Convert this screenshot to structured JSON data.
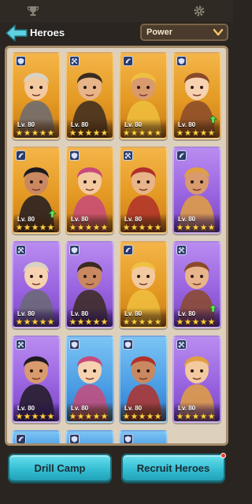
{
  "header": {
    "title": "Heroes",
    "sort_label": "Power",
    "icons": [
      "trophy-icon",
      "gear-icon",
      "back-arrow-icon",
      "chevron-down-icon"
    ]
  },
  "colors": {
    "orange_rarity": "#e49a24",
    "purple_rarity": "#9a64e0",
    "blue_rarity": "#4a9ce4",
    "button_cyan": "#35bfd4"
  },
  "heroes": [
    {
      "id": "hero-1",
      "level_text": "Lv. 80",
      "stars": 5,
      "rarity": "orange",
      "class": "shield",
      "upgrade": false
    },
    {
      "id": "hero-2",
      "level_text": "Lv. 80",
      "stars": 5,
      "rarity": "orange",
      "class": "sword",
      "upgrade": false
    },
    {
      "id": "hero-3",
      "level_text": "Lv. 80",
      "stars": 5,
      "rarity": "orange",
      "class": "magic",
      "upgrade": false
    },
    {
      "id": "hero-4",
      "level_text": "Lv. 80",
      "stars": 5,
      "rarity": "orange",
      "class": "shield",
      "upgrade": true
    },
    {
      "id": "hero-5",
      "level_text": "Lv. 80",
      "stars": 5,
      "rarity": "orange",
      "class": "magic",
      "upgrade": true
    },
    {
      "id": "hero-6",
      "level_text": "Lv. 80",
      "stars": 5,
      "rarity": "orange",
      "class": "shield",
      "upgrade": false
    },
    {
      "id": "hero-7",
      "level_text": "Lv. 80",
      "stars": 5,
      "rarity": "orange",
      "class": "sword",
      "upgrade": false
    },
    {
      "id": "hero-8",
      "level_text": "Lv. 80",
      "stars": 5,
      "rarity": "purple",
      "class": "magic",
      "upgrade": false
    },
    {
      "id": "hero-9",
      "level_text": "Lv. 80",
      "stars": 5,
      "rarity": "purple",
      "class": "sword",
      "upgrade": false
    },
    {
      "id": "hero-10",
      "level_text": "Lv. 80",
      "stars": 5,
      "rarity": "purple",
      "class": "shield",
      "upgrade": false
    },
    {
      "id": "hero-11",
      "level_text": "Lv. 80",
      "stars": 5,
      "rarity": "orange",
      "class": "magic",
      "upgrade": false
    },
    {
      "id": "hero-12",
      "level_text": "Lv. 80",
      "stars": 5,
      "rarity": "purple",
      "class": "sword",
      "upgrade": true
    },
    {
      "id": "hero-13",
      "level_text": "Lv. 80",
      "stars": 5,
      "rarity": "purple",
      "class": "sword",
      "upgrade": false
    },
    {
      "id": "hero-14",
      "level_text": "Lv. 80",
      "stars": 5,
      "rarity": "blue",
      "class": "shield",
      "upgrade": false
    },
    {
      "id": "hero-15",
      "level_text": "Lv. 80",
      "stars": 5,
      "rarity": "blue",
      "class": "shield",
      "upgrade": false
    },
    {
      "id": "hero-16",
      "level_text": "Lv. 80",
      "stars": 5,
      "rarity": "purple",
      "class": "sword",
      "upgrade": false
    },
    {
      "id": "hero-17",
      "level_text": "",
      "stars": 0,
      "rarity": "blue",
      "class": "magic",
      "upgrade": false
    },
    {
      "id": "hero-18",
      "level_text": "",
      "stars": 0,
      "rarity": "blue",
      "class": "shield",
      "upgrade": false
    },
    {
      "id": "hero-19",
      "level_text": "",
      "stars": 0,
      "rarity": "blue",
      "class": "shield",
      "upgrade": false
    }
  ],
  "buttons": {
    "drill_camp": "Drill Camp",
    "recruit_heroes": "Recruit Heroes"
  }
}
